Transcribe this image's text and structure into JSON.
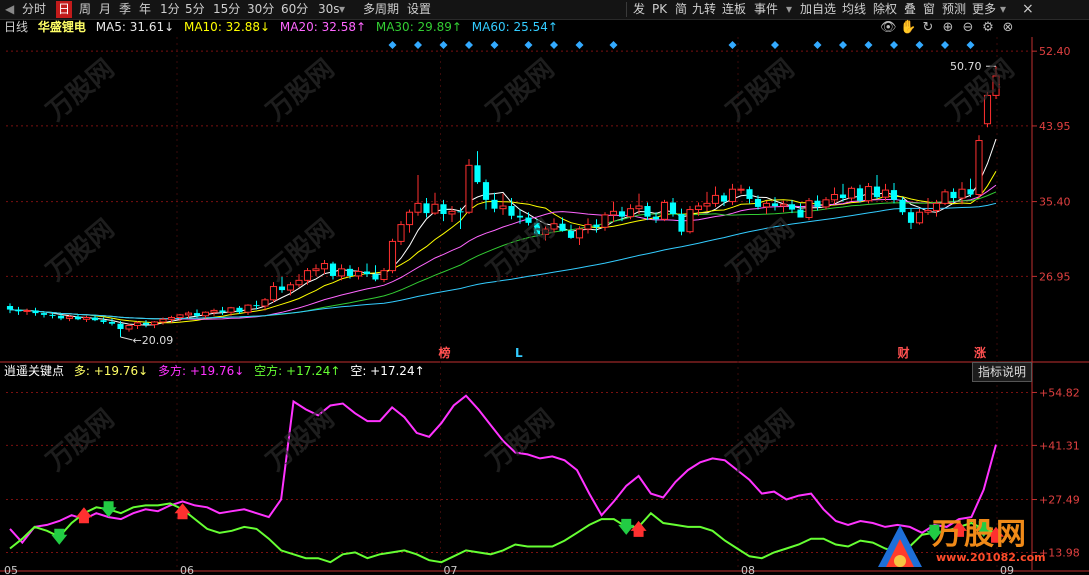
{
  "toolbar": {
    "items": [
      "分时",
      "日",
      "周",
      "月",
      "季",
      "年",
      "1分",
      "5分",
      "15分",
      "30分",
      "60分",
      "30s",
      "多周期",
      "设置"
    ],
    "selected": "日",
    "right_items": [
      "发",
      "PK",
      "简",
      "九转",
      "连板",
      "事件",
      "加自选",
      "均线",
      "除权",
      "叠",
      "窗",
      "预测",
      "更多"
    ],
    "dropdown_glyph": "▾",
    "left_glyph": "◀",
    "close_glyph": "×"
  },
  "info": {
    "period": "日线",
    "name": "华盛锂电",
    "ma5": "MA5: 31.61↓",
    "ma10": "MA10: 32.88↓",
    "ma20": "MA20: 32.58↑",
    "ma30": "MA30: 29.89↑",
    "ma60": "MA60: 25.54↑"
  },
  "colors": {
    "ma5": "#ffffff",
    "ma10": "#ffff00",
    "ma20": "#ff66ff",
    "ma30": "#33cc33",
    "ma60": "#33ccff",
    "up": "#ff3030",
    "down": "#00ffff",
    "grid": "#7a1010",
    "axis": "#c03030",
    "magenta": "#ff33ff",
    "green": "#66ff33",
    "diamond": "#33aaff"
  },
  "price_axis": [
    "52.40",
    "43.95",
    "35.40",
    "26.95"
  ],
  "sub_axis": [
    "+54.82",
    "+41.31",
    "+27.49",
    "+13.98"
  ],
  "annotations": {
    "high": "50.70",
    "low": "20.09",
    "marks": [
      "榜",
      "L",
      "财",
      "涨"
    ]
  },
  "sub": {
    "name": "逍遥关键点",
    "duo": "多: +19.76↓",
    "duofang": "多方: +19.76↓",
    "kongfang": "空方: +17.24↑",
    "kong": "空: +17.24↑",
    "help": "指标说明"
  },
  "date_labels": [
    "05",
    "06",
    "07",
    "08",
    "09"
  ],
  "watermark": {
    "brand": "万股网",
    "url": "www.201082.com"
  },
  "chart_data": {
    "type": "line",
    "title": "",
    "ylabel": "",
    "ylim": [
      17.5,
      54.0
    ],
    "candles": [
      [
        23.6,
        23.9,
        22.8,
        23.2
      ],
      [
        23.2,
        23.5,
        22.6,
        23.0
      ],
      [
        23.0,
        23.3,
        22.6,
        23.1
      ],
      [
        23.1,
        23.4,
        22.5,
        22.8
      ],
      [
        22.8,
        23.0,
        22.3,
        22.6
      ],
      [
        22.6,
        22.9,
        22.2,
        22.5
      ],
      [
        22.5,
        22.8,
        22.0,
        22.2
      ],
      [
        22.2,
        22.6,
        21.9,
        22.4
      ],
      [
        22.4,
        22.7,
        22.0,
        22.1
      ],
      [
        22.1,
        22.5,
        21.8,
        22.3
      ],
      [
        22.3,
        22.6,
        21.9,
        22.0
      ],
      [
        22.0,
        22.3,
        21.6,
        21.8
      ],
      [
        21.8,
        22.2,
        21.4,
        21.6
      ],
      [
        21.6,
        21.9,
        20.1,
        21.0
      ],
      [
        21.0,
        21.6,
        20.7,
        21.4
      ],
      [
        21.4,
        21.9,
        21.0,
        21.7
      ],
      [
        21.7,
        22.0,
        21.2,
        21.5
      ],
      [
        21.5,
        21.9,
        21.1,
        21.8
      ],
      [
        21.8,
        22.3,
        21.5,
        22.1
      ],
      [
        22.1,
        22.5,
        21.7,
        22.3
      ],
      [
        22.3,
        22.7,
        21.9,
        22.6
      ],
      [
        22.6,
        23.0,
        22.2,
        22.8
      ],
      [
        22.8,
        23.2,
        22.3,
        22.5
      ],
      [
        22.5,
        23.0,
        22.2,
        22.9
      ],
      [
        22.9,
        23.3,
        22.5,
        23.1
      ],
      [
        23.1,
        23.5,
        22.6,
        22.9
      ],
      [
        22.9,
        23.5,
        22.5,
        23.4
      ],
      [
        23.4,
        23.6,
        22.7,
        22.9
      ],
      [
        22.9,
        23.8,
        22.6,
        23.7
      ],
      [
        23.7,
        24.2,
        23.2,
        23.6
      ],
      [
        23.6,
        24.5,
        23.1,
        24.3
      ],
      [
        24.3,
        26.3,
        24.0,
        25.8
      ],
      [
        25.8,
        26.9,
        25.1,
        25.4
      ],
      [
        25.4,
        26.3,
        24.8,
        26.0
      ],
      [
        26.0,
        27.2,
        25.7,
        26.5
      ],
      [
        26.5,
        27.9,
        26.0,
        27.6
      ],
      [
        27.6,
        28.3,
        27.0,
        27.8
      ],
      [
        27.8,
        28.8,
        27.2,
        28.4
      ],
      [
        28.4,
        28.6,
        26.6,
        27.0
      ],
      [
        27.0,
        28.3,
        26.5,
        27.8
      ],
      [
        27.8,
        28.2,
        26.7,
        27.0
      ],
      [
        27.0,
        28.0,
        26.6,
        27.5
      ],
      [
        27.5,
        28.4,
        26.9,
        27.2
      ],
      [
        27.2,
        28.2,
        26.4,
        26.6
      ],
      [
        26.6,
        27.9,
        26.3,
        27.6
      ],
      [
        27.6,
        31.2,
        27.3,
        30.9
      ],
      [
        30.9,
        33.2,
        30.5,
        32.8
      ],
      [
        32.8,
        34.5,
        31.9,
        34.2
      ],
      [
        34.2,
        38.4,
        33.8,
        35.2
      ],
      [
        35.2,
        35.8,
        33.6,
        34.1
      ],
      [
        34.1,
        36.4,
        33.9,
        35.1
      ],
      [
        35.1,
        35.6,
        33.2,
        34.0
      ],
      [
        34.0,
        34.9,
        33.1,
        34.3
      ],
      [
        34.3,
        34.7,
        32.3,
        34.2
      ],
      [
        34.2,
        40.2,
        34.0,
        39.5
      ],
      [
        39.5,
        41.1,
        37.4,
        37.6
      ],
      [
        37.6,
        37.9,
        34.5,
        35.6
      ],
      [
        35.6,
        36.4,
        34.2,
        34.6
      ],
      [
        34.6,
        36.3,
        33.9,
        34.9
      ],
      [
        34.9,
        35.8,
        33.4,
        33.8
      ],
      [
        33.8,
        34.5,
        32.9,
        33.6
      ],
      [
        33.6,
        34.2,
        32.7,
        33.0
      ],
      [
        33.0,
        33.4,
        31.4,
        31.7
      ],
      [
        31.7,
        32.6,
        31.0,
        32.3
      ],
      [
        32.3,
        33.5,
        31.9,
        32.9
      ],
      [
        32.9,
        33.6,
        32.0,
        32.1
      ],
      [
        32.1,
        32.8,
        31.2,
        31.3
      ],
      [
        31.3,
        32.6,
        30.5,
        32.3
      ],
      [
        32.3,
        33.5,
        31.8,
        32.8
      ],
      [
        32.8,
        33.4,
        31.9,
        32.5
      ],
      [
        32.5,
        34.2,
        32.1,
        33.9
      ],
      [
        33.9,
        35.4,
        33.1,
        34.3
      ],
      [
        34.3,
        34.8,
        33.2,
        33.7
      ],
      [
        33.7,
        35.1,
        33.4,
        34.6
      ],
      [
        34.6,
        36.3,
        34.0,
        34.9
      ],
      [
        34.9,
        35.3,
        33.3,
        33.7
      ],
      [
        33.7,
        34.2,
        33.0,
        33.4
      ],
      [
        33.4,
        35.6,
        33.2,
        35.3
      ],
      [
        35.3,
        35.8,
        33.7,
        34.0
      ],
      [
        34.0,
        34.6,
        31.6,
        32.0
      ],
      [
        32.0,
        34.9,
        31.8,
        34.5
      ],
      [
        34.5,
        35.3,
        33.8,
        34.9
      ],
      [
        34.9,
        36.5,
        34.3,
        35.2
      ],
      [
        35.2,
        37.1,
        34.8,
        36.1
      ],
      [
        36.1,
        36.4,
        34.9,
        35.4
      ],
      [
        35.4,
        37.4,
        35.0,
        36.8
      ],
      [
        36.8,
        37.3,
        36.3,
        36.8
      ],
      [
        36.8,
        37.1,
        35.2,
        35.7
      ],
      [
        35.7,
        36.1,
        34.5,
        34.8
      ],
      [
        34.8,
        35.5,
        34.0,
        35.2
      ],
      [
        35.2,
        35.9,
        34.4,
        34.9
      ],
      [
        34.9,
        35.5,
        34.2,
        35.1
      ],
      [
        35.1,
        35.6,
        34.1,
        34.5
      ],
      [
        34.5,
        35.2,
        33.6,
        33.6
      ],
      [
        33.6,
        35.8,
        33.3,
        35.5
      ],
      [
        35.5,
        36.1,
        34.4,
        34.8
      ],
      [
        34.8,
        35.9,
        34.5,
        35.6
      ],
      [
        35.6,
        37.0,
        35.1,
        36.2
      ],
      [
        36.2,
        37.4,
        35.4,
        35.8
      ],
      [
        35.8,
        37.1,
        35.5,
        36.9
      ],
      [
        36.9,
        37.3,
        35.3,
        35.5
      ],
      [
        35.5,
        37.5,
        35.2,
        37.1
      ],
      [
        37.1,
        38.4,
        35.7,
        35.9
      ],
      [
        35.9,
        37.4,
        35.5,
        36.7
      ],
      [
        36.7,
        37.5,
        35.2,
        35.6
      ],
      [
        35.6,
        35.9,
        33.9,
        34.2
      ],
      [
        34.2,
        34.6,
        32.3,
        33.0
      ],
      [
        33.0,
        34.6,
        32.8,
        34.2
      ],
      [
        34.2,
        35.8,
        33.9,
        34.4
      ],
      [
        34.4,
        35.6,
        33.7,
        35.2
      ],
      [
        35.2,
        36.8,
        35.0,
        36.5
      ],
      [
        36.5,
        36.9,
        35.3,
        35.8
      ],
      [
        35.8,
        37.6,
        35.1,
        36.8
      ],
      [
        36.8,
        38.0,
        35.9,
        36.2
      ],
      [
        36.2,
        42.9,
        35.8,
        42.3
      ],
      [
        44.2,
        47.8,
        43.8,
        47.4
      ],
      [
        47.4,
        50.7,
        47.0,
        49.6
      ]
    ],
    "ma_series": [
      {
        "name": "MA5",
        "last": 31.61
      },
      {
        "name": "MA10",
        "last": 32.88
      },
      {
        "name": "MA20",
        "last": 32.58
      },
      {
        "name": "MA30",
        "last": 29.89
      },
      {
        "name": "MA60",
        "last": 25.54
      }
    ],
    "sub_ylim": [
      9.5,
      58.0
    ],
    "sub_magenta": [
      20.0,
      16.5,
      20.5,
      21.0,
      22.0,
      23.5,
      22.5,
      24.0,
      23.0,
      22.5,
      24.0,
      25.0,
      24.5,
      26.0,
      27.0,
      26.0,
      25.5,
      24.0,
      24.5,
      25.0,
      24.0,
      23.0,
      27.5,
      52.5,
      50.5,
      49.0,
      51.5,
      52.0,
      49.5,
      47.5,
      47.5,
      51.0,
      48.5,
      44.5,
      43.5,
      47.0,
      51.5,
      54.0,
      50.5,
      46.5,
      42.5,
      39.5,
      39.0,
      38.0,
      38.5,
      37.5,
      35.0,
      29.0,
      23.5,
      27.0,
      31.0,
      33.5,
      29.0,
      28.0,
      32.0,
      35.0,
      37.0,
      38.0,
      37.5,
      35.0,
      32.5,
      29.0,
      29.5,
      27.5,
      28.5,
      29.0,
      25.0,
      22.0,
      21.0,
      22.0,
      21.5,
      20.5,
      21.0,
      20.5,
      19.0,
      21.0,
      20.5,
      22.5,
      23.0,
      30.0,
      41.5
    ],
    "sub_green": [
      15.0,
      17.5,
      20.5,
      19.5,
      18.0,
      21.5,
      24.0,
      25.5,
      25.0,
      24.0,
      25.5,
      26.0,
      26.0,
      26.5,
      25.0,
      22.5,
      20.0,
      19.0,
      19.5,
      20.5,
      20.0,
      17.5,
      14.5,
      13.5,
      12.5,
      12.5,
      11.5,
      13.5,
      14.0,
      12.5,
      13.5,
      14.0,
      14.5,
      13.5,
      12.0,
      11.5,
      13.0,
      14.5,
      14.0,
      13.5,
      14.5,
      16.0,
      15.5,
      15.5,
      15.5,
      17.0,
      19.0,
      21.0,
      22.5,
      22.5,
      20.5,
      20.5,
      24.0,
      21.5,
      21.0,
      20.5,
      20.5,
      19.5,
      17.0,
      15.0,
      13.0,
      12.5,
      14.0,
      15.0,
      16.0,
      17.5,
      17.5,
      16.0,
      15.5,
      17.0,
      16.5,
      15.0,
      14.0,
      15.5,
      18.5,
      19.0,
      19.5,
      20.5,
      21.5,
      20.0,
      19.0
    ]
  }
}
